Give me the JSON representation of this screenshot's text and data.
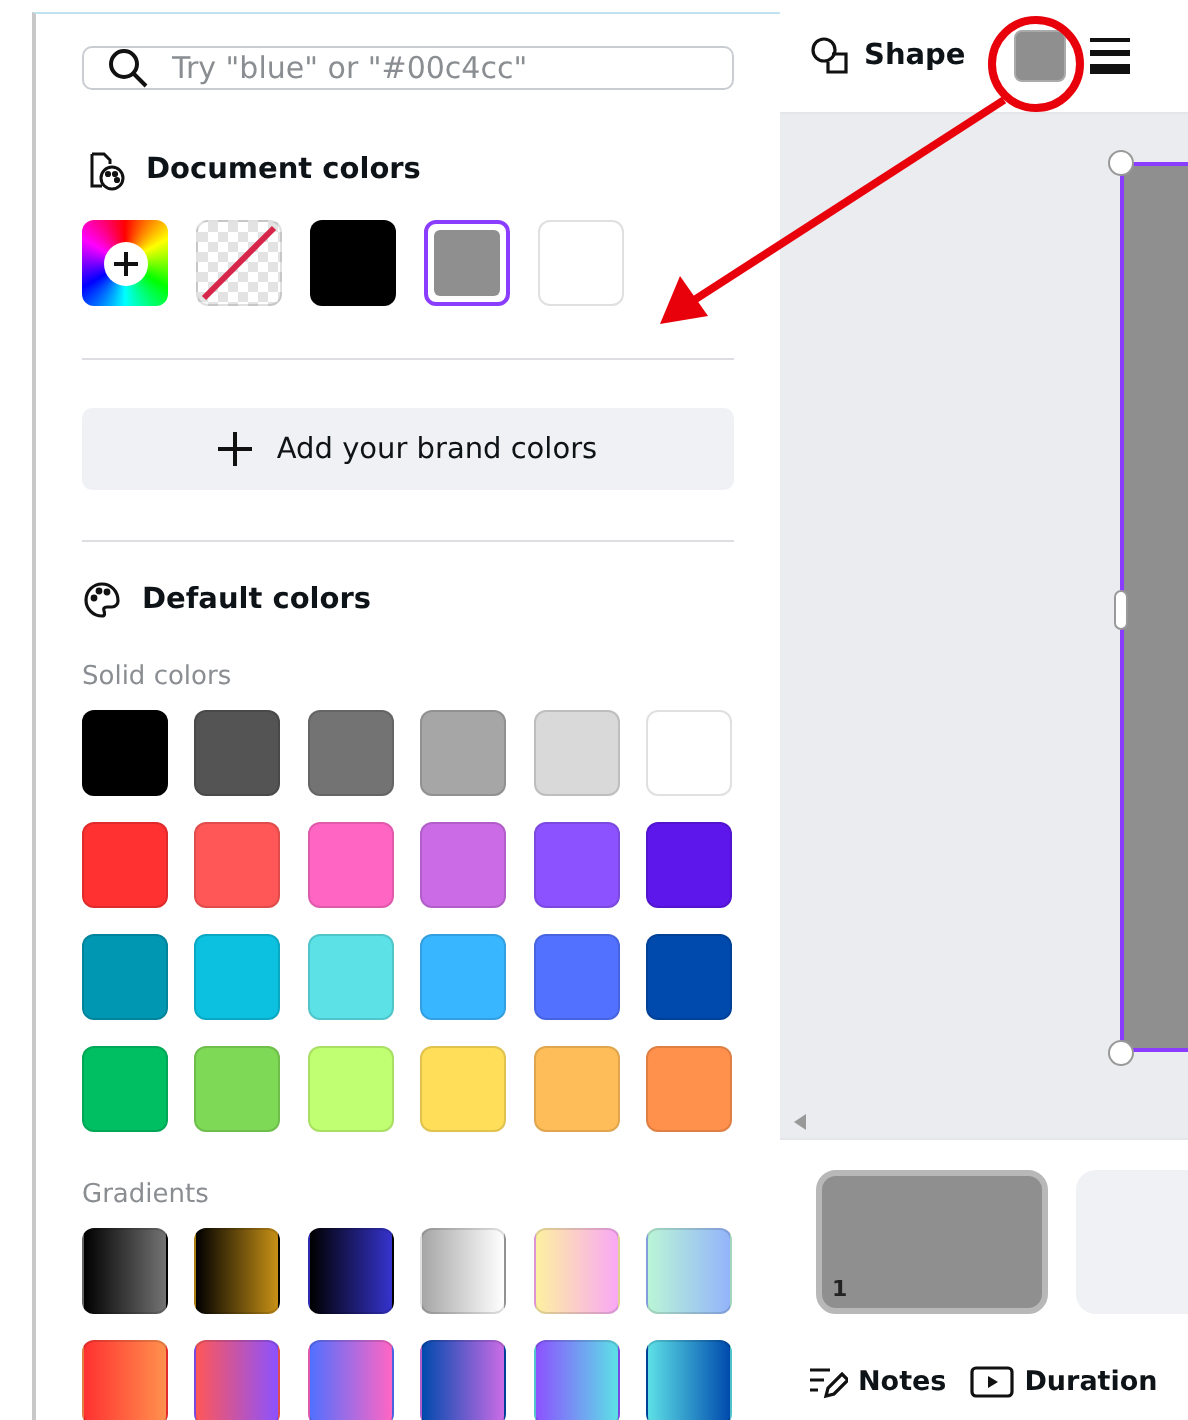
{
  "search": {
    "placeholder": "Try \"blue\" or \"#00c4cc\""
  },
  "document_colors": {
    "title": "Document colors",
    "swatches": [
      {
        "kind": "add",
        "selected": false
      },
      {
        "kind": "none",
        "selected": false
      },
      {
        "kind": "color",
        "color": "#000000",
        "selected": false
      },
      {
        "kind": "color",
        "color": "#8f8f8f",
        "selected": true
      },
      {
        "kind": "color",
        "color": "#ffffff",
        "selected": false
      }
    ]
  },
  "brand_button": {
    "label": "Add your brand colors"
  },
  "default_colors": {
    "title": "Default colors",
    "groups": [
      {
        "label": "Solid colors",
        "kind": "solid",
        "swatches": [
          {
            "color": "#000000"
          },
          {
            "color": "#545454"
          },
          {
            "color": "#737373"
          },
          {
            "color": "#a6a6a6"
          },
          {
            "color": "#d9d9d9"
          },
          {
            "color": "#ffffff"
          },
          {
            "color": "#ff3131"
          },
          {
            "color": "#ff5757"
          },
          {
            "color": "#ff66c4"
          },
          {
            "color": "#cb6ce6"
          },
          {
            "color": "#8c52ff"
          },
          {
            "color": "#5e17eb"
          },
          {
            "color": "#0097b2"
          },
          {
            "color": "#0cc0df"
          },
          {
            "color": "#5ce1e6"
          },
          {
            "color": "#38b6ff"
          },
          {
            "color": "#5271ff"
          },
          {
            "color": "#004aad"
          },
          {
            "color": "#00bf63"
          },
          {
            "color": "#7ed957"
          },
          {
            "color": "#c1ff72"
          },
          {
            "color": "#ffde59"
          },
          {
            "color": "#ffbd59"
          },
          {
            "color": "#ff914d"
          }
        ]
      },
      {
        "label": "Gradients",
        "kind": "gradient",
        "swatches": [
          {
            "stops": [
              {
                "color": "#000000"
              },
              {
                "color": "#737373"
              }
            ]
          },
          {
            "stops": [
              {
                "color": "#000000"
              },
              {
                "color": "#c89116"
              }
            ]
          },
          {
            "stops": [
              {
                "color": "#000000"
              },
              {
                "color": "#3533cd"
              }
            ]
          },
          {
            "stops": [
              {
                "color": "#a6a6a6"
              },
              {
                "color": "#ffffff"
              }
            ]
          },
          {
            "stops": [
              {
                "color": "#fdf0a0"
              },
              {
                "color": "#f9a8f5"
              }
            ]
          },
          {
            "stops": [
              {
                "color": "#baf5d6"
              },
              {
                "color": "#93b4fa"
              }
            ]
          },
          {
            "stops": [
              {
                "color": "#ff3131"
              },
              {
                "color": "#ff914d"
              }
            ]
          },
          {
            "stops": [
              {
                "color": "#ff5757"
              },
              {
                "color": "#8c52ff"
              }
            ]
          },
          {
            "stops": [
              {
                "color": "#5170ff"
              },
              {
                "color": "#ff66c4"
              }
            ]
          },
          {
            "stops": [
              {
                "color": "#004aad"
              },
              {
                "color": "#cb6ce6"
              }
            ]
          },
          {
            "stops": [
              {
                "color": "#8c52ff"
              },
              {
                "color": "#5ce1e6"
              }
            ]
          },
          {
            "stops": [
              {
                "color": "#5de0e6"
              },
              {
                "color": "#004aad"
              }
            ]
          }
        ]
      }
    ]
  },
  "toolbar": {
    "shape_label": "Shape",
    "fill": {
      "color": "#8f8f8f"
    }
  },
  "pages": [
    {
      "number": "1",
      "selected": true
    },
    {
      "selected": false
    }
  ],
  "footer": {
    "notes": "Notes",
    "duration": "Duration"
  }
}
